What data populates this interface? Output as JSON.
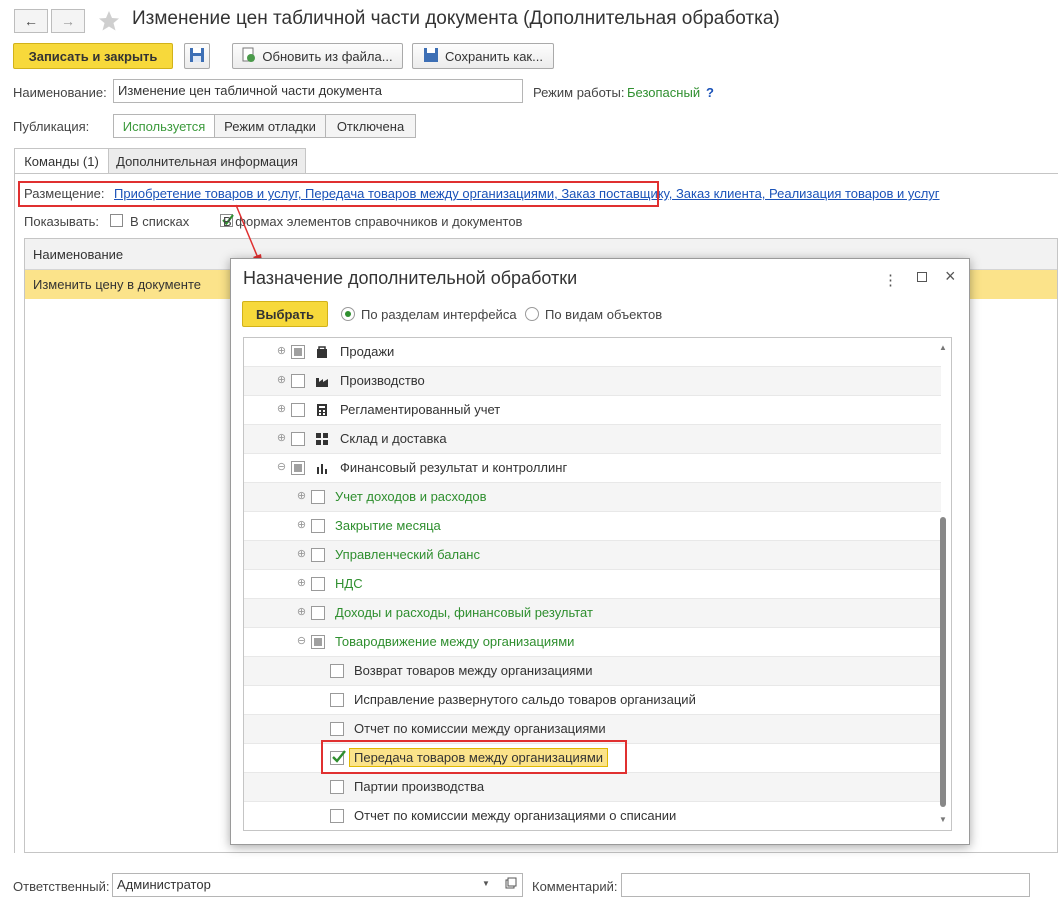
{
  "window": {
    "title": "Изменение цен табличной части документа (Дополнительная обработка)",
    "back_symbol": "←",
    "forward_symbol": "→"
  },
  "toolbar": {
    "save_close_label": "Записать и закрыть",
    "update_from_file_label": "Обновить из файла...",
    "save_as_label": "Сохранить как..."
  },
  "form": {
    "name_label": "Наименование:",
    "name_value": "Изменение цен табличной части документа",
    "mode_label": "Режим работы:",
    "mode_value": "Безопасный",
    "mode_help": "?",
    "publication_label": "Публикация:",
    "publication_options": [
      "Используется",
      "Режим отладки",
      "Отключена"
    ]
  },
  "tabs": [
    "Команды (1)",
    "Дополнительная информация"
  ],
  "placement": {
    "label": "Размещение:",
    "value": "Приобретение товаров и услуг, Передача товаров между организациями, Заказ поставщику, Заказ клиента, Реализация товаров и услуг"
  },
  "show": {
    "label": "Показывать:",
    "in_lists": "В списках",
    "in_forms": "В формах элементов справочников и документов"
  },
  "commands_table": {
    "header": "Наименование",
    "rows": [
      "Изменить цену в документе"
    ]
  },
  "footer": {
    "responsible_label": "Ответственный:",
    "responsible_value": "Администратор",
    "comment_label": "Комментарий:",
    "comment_value": ""
  },
  "dialog": {
    "title": "Назначение дополнительной обработки",
    "select_button": "Выбрать",
    "radio_by_sections": "По разделам интерфейса",
    "radio_by_objects": "По видам объектов",
    "tree": [
      {
        "label": "Продажи",
        "level": 0,
        "expander": "plus",
        "check": "partial",
        "icon": "bag-icon"
      },
      {
        "label": "Производство",
        "level": 0,
        "expander": "plus",
        "check": "none",
        "icon": "factory-icon"
      },
      {
        "label": "Регламентированный учет",
        "level": 0,
        "expander": "plus",
        "check": "none",
        "icon": "calculator-icon"
      },
      {
        "label": "Склад и доставка",
        "level": 0,
        "expander": "plus",
        "check": "none",
        "icon": "warehouse-icon"
      },
      {
        "label": "Финансовый результат и контроллинг",
        "level": 0,
        "expander": "minus",
        "check": "partial",
        "icon": "chart-icon"
      },
      {
        "label": "Учет доходов и расходов",
        "level": 1,
        "expander": "plus",
        "check": "none"
      },
      {
        "label": "Закрытие месяца",
        "level": 1,
        "expander": "plus",
        "check": "none"
      },
      {
        "label": "Управленческий баланс",
        "level": 1,
        "expander": "plus",
        "check": "none"
      },
      {
        "label": "НДС",
        "level": 1,
        "expander": "plus",
        "check": "none"
      },
      {
        "label": "Доходы и расходы, финансовый результат",
        "level": 1,
        "expander": "plus",
        "check": "none"
      },
      {
        "label": "Товародвижение между организациями",
        "level": 1,
        "expander": "minus",
        "check": "partial"
      },
      {
        "label": "Возврат товаров между организациями",
        "level": 2,
        "expander": "",
        "check": "none"
      },
      {
        "label": "Исправление развернутого сальдо товаров организаций",
        "level": 2,
        "expander": "",
        "check": "none"
      },
      {
        "label": "Отчет по комиссии между организациями",
        "level": 2,
        "expander": "",
        "check": "none"
      },
      {
        "label": "Передача товаров между организациями",
        "level": 2,
        "expander": "",
        "check": "checked"
      },
      {
        "label": "Партии производства",
        "level": 2,
        "expander": "",
        "check": "none"
      },
      {
        "label": "Отчет по комиссии между организациями о списании",
        "level": 2,
        "expander": "",
        "check": "none"
      }
    ]
  },
  "colors": {
    "accent_yellow": "#f7d93b",
    "selected_row": "#fbe38a",
    "green_text": "#2f8f2f",
    "link_blue": "#1a52b8",
    "highlight_red": "#e03030"
  }
}
